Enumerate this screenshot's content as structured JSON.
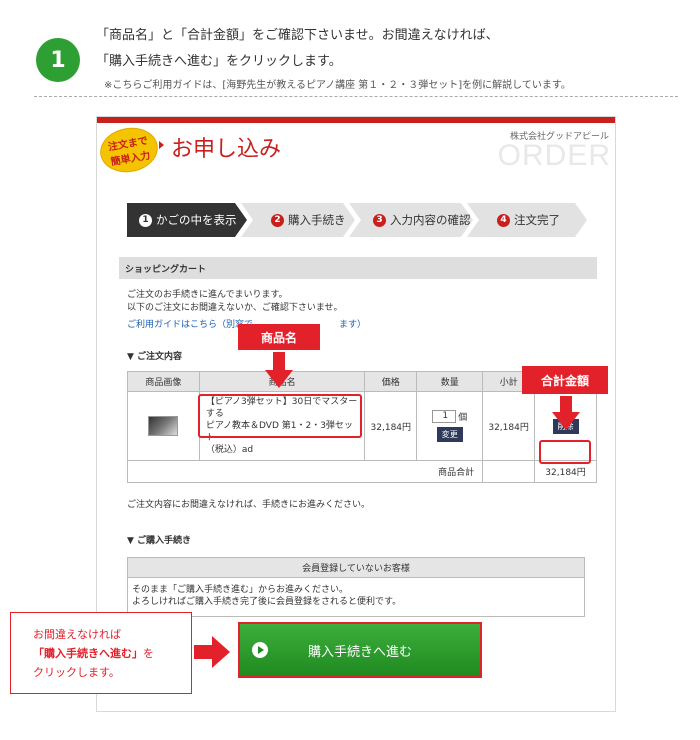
{
  "step": {
    "number": "1",
    "line1": "「商品名」と「合計金額」をご確認下さいませ。お間違えなければ、",
    "line2": "「購入手続きへ進む」をクリックします。",
    "note": "※こちらご利用ガイドは、[海野先生が教えるピアノ講座 第１・２・３弾セット]を例に解説しています。"
  },
  "order_page": {
    "badge": [
      "注文まで",
      "簡単入力"
    ],
    "title": "お申し込み",
    "company": "株式会社グッドアピール",
    "bg_word": "ORDER",
    "progress": [
      {
        "num": "1",
        "label": "かごの中を表示",
        "active": true
      },
      {
        "num": "2",
        "label": "購入手続き",
        "active": false
      },
      {
        "num": "3",
        "label": "入力内容の確認",
        "active": false
      },
      {
        "num": "4",
        "label": "注文完了",
        "active": false
      }
    ],
    "section_title": "ショッピングカート",
    "intro_line1": "ご注文のお手続きに進んでまいります。",
    "intro_line2": "以下のご注文にお間違えないか、ご確認下さいませ。",
    "guide_link_left": "ご利用ガイドはこちら（別窓で",
    "guide_link_right": "ます）",
    "order_contents_heading": "▼ ご注文内容",
    "table": {
      "headers": [
        "商品画像",
        "商品名",
        "価格",
        "数量",
        "小計",
        ""
      ],
      "item": {
        "name_line1": "【ピアノ3弾セット】30日でマスターする",
        "name_line2": "ピアノ教本＆DVD 第1・2・3弾セット",
        "name_line3": "（税込）ad",
        "price": "32,184円",
        "qty": "1",
        "qty_unit": "個",
        "change_label": "変更",
        "subtotal": "32,184円",
        "delete_label": "削除"
      },
      "total_label": "商品合計",
      "total_value": "32,184円"
    },
    "confirm_text": "ご注文内容にお間違えなければ、手続きにお進みください。",
    "purchase_heading": "▼ ご購入手続き",
    "customer_box": {
      "head": "会員登録していないお客様",
      "line1": "そのまま「ご購入手続き進む」からお進みください。",
      "line2": "よろしければご購入手続き完了後に会員登録をされると便利です。"
    },
    "proceed_button": "購入手続きへ進む"
  },
  "annotations": {
    "product_name_label": "商品名",
    "total_label": "合計金額",
    "instruction_line1": "お間違えなければ",
    "instruction_line2_bold": "「購入手続きへ進む」",
    "instruction_line2_rest": "を",
    "instruction_line3": "クリックします。"
  },
  "colors": {
    "accent_red": "#e3212b",
    "step_green": "#2e9f33",
    "button_green": "#2c9c2c",
    "nav_dark": "#2f3a5a"
  }
}
